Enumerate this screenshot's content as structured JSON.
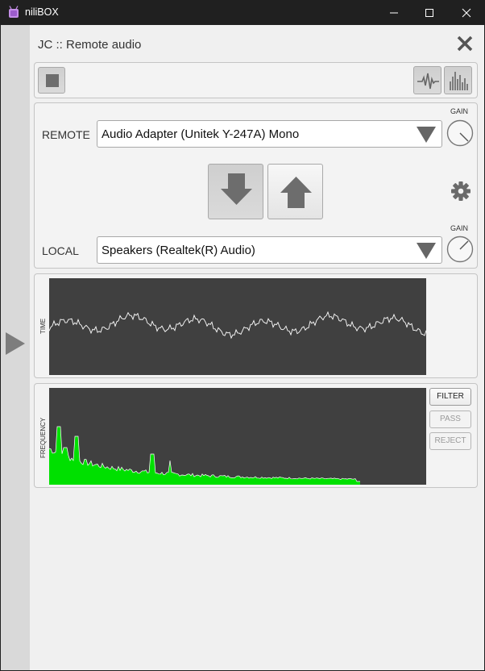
{
  "window": {
    "title": "niliBOX"
  },
  "header": {
    "title": "JC :: Remote audio"
  },
  "remote": {
    "label": "REMOTE",
    "device": "Audio Adapter (Unitek Y-247A) Mono",
    "gain_label": "GAIN"
  },
  "local": {
    "label": "LOCAL",
    "device": "Speakers (Realtek(R) Audio)",
    "gain_label": "GAIN"
  },
  "time_scope": {
    "label": "TIME"
  },
  "freq_scope": {
    "label": "FREQUENCY"
  },
  "filter": {
    "filter_label": "FILTER",
    "pass_label": "PASS",
    "reject_label": "REJECT"
  },
  "colors": {
    "spectrum_fill": "#00e000",
    "scope_bg": "#404040",
    "titlebar_bg": "#202020"
  },
  "icons": {
    "app": "app-icon",
    "stop": "stop-icon",
    "waveform": "waveform-icon",
    "spectrum": "spectrum-icon",
    "download": "arrow-down-icon",
    "upload": "arrow-up-icon",
    "settings": "gear-icon",
    "expand": "play-triangle-icon",
    "close": "close-icon"
  }
}
